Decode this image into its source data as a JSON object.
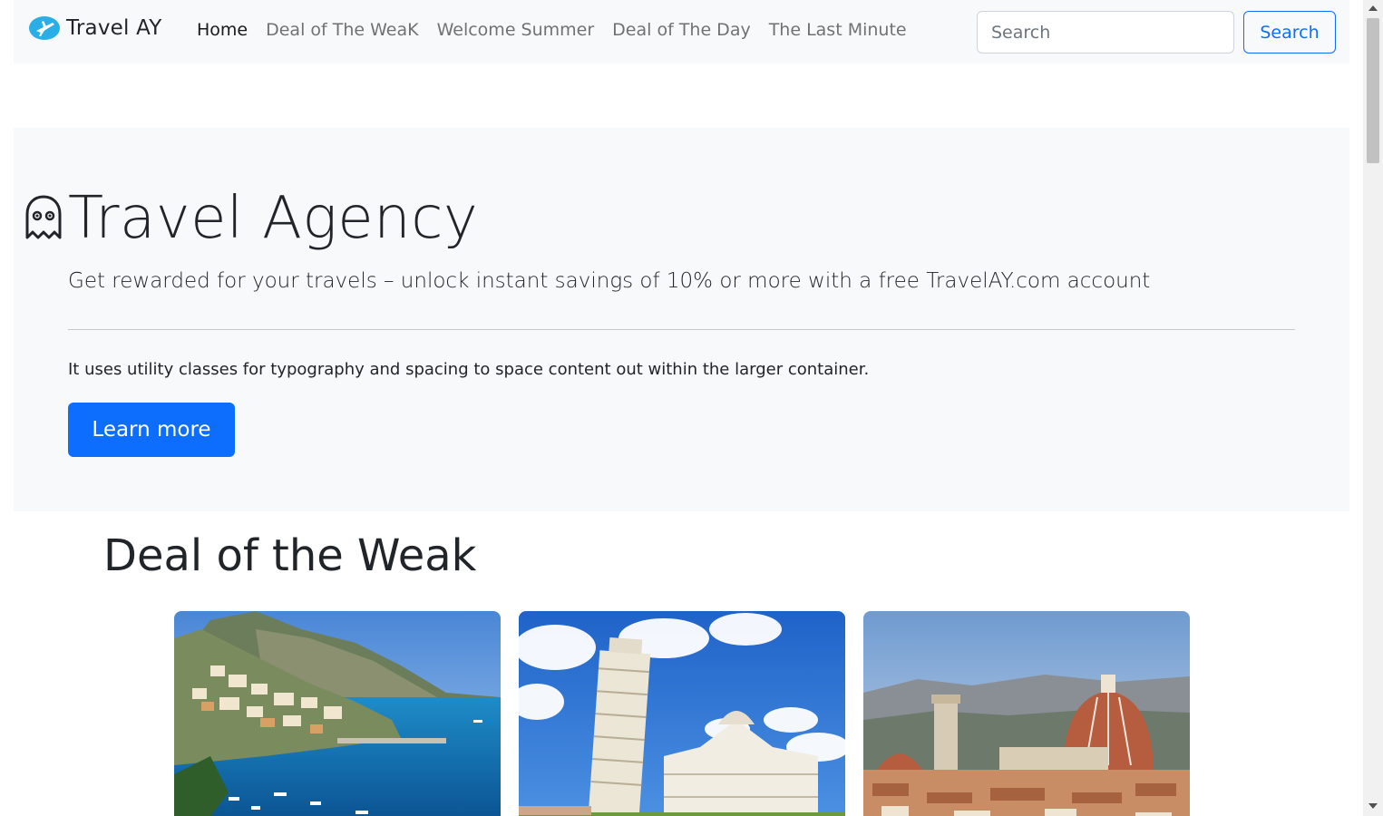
{
  "navbar": {
    "brand": "Travel AY",
    "brand_icon": "airplane-logo-icon",
    "links": [
      {
        "label": "Home",
        "active": true
      },
      {
        "label": "Deal of The WeaK",
        "active": false
      },
      {
        "label": "Welcome Summer",
        "active": false
      },
      {
        "label": "Deal of The Day",
        "active": false
      },
      {
        "label": "The Last Minute",
        "active": false
      }
    ],
    "search_placeholder": "Search",
    "search_button": "Search"
  },
  "hero": {
    "icon": "ghost-icon",
    "title": "Travel Agency",
    "lead": "Get rewarded for your travels – unlock instant savings of 10% or more with a free TravelAY.com account",
    "text": "It uses utility classes for typography and spacing to space content out within the larger container.",
    "button": "Learn more"
  },
  "deals": {
    "title": "Deal of the Weak",
    "cards": [
      {
        "image": "coastal-village-photo"
      },
      {
        "image": "leaning-tower-photo"
      },
      {
        "image": "cathedral-dome-photo"
      }
    ]
  },
  "colors": {
    "primary": "#0d6efd",
    "navbar_bg": "#f8f9fa",
    "text": "#212529"
  }
}
